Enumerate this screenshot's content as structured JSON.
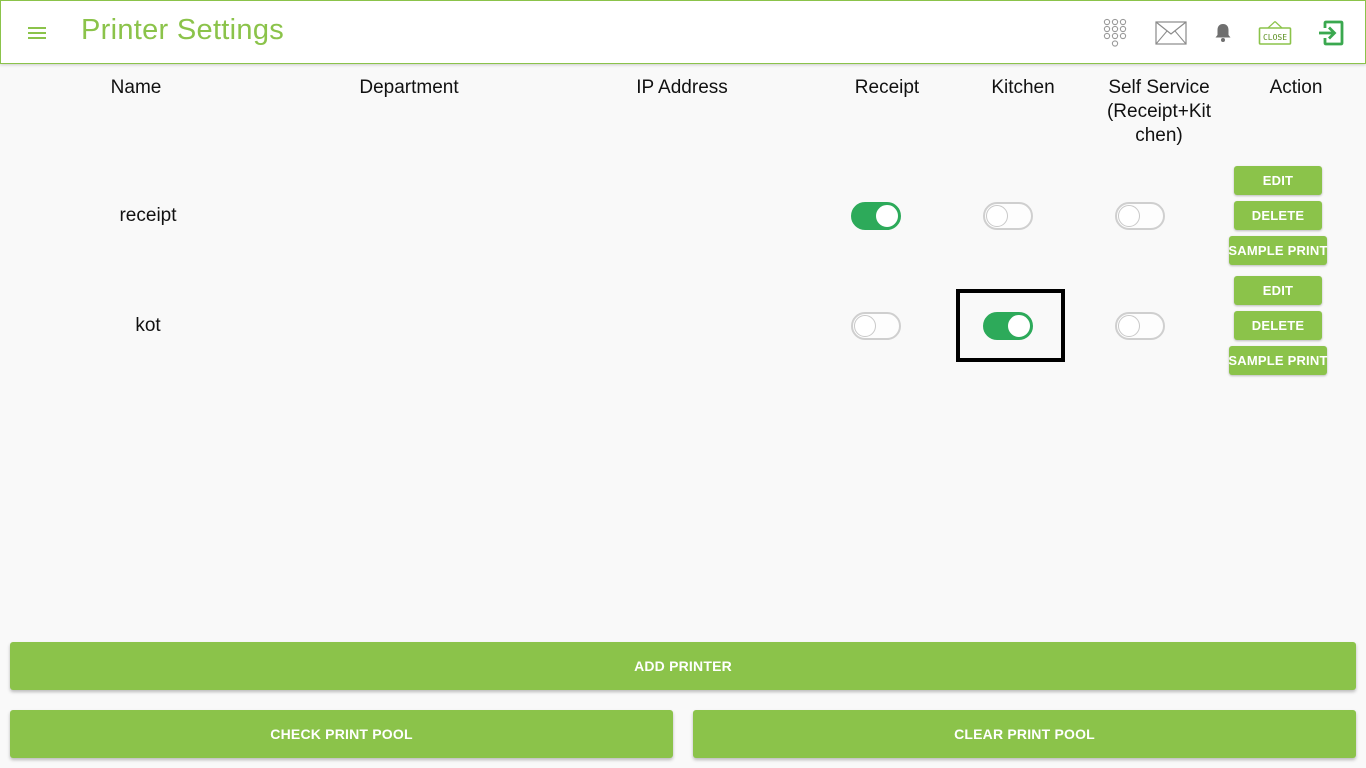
{
  "header": {
    "title": "Printer Settings",
    "close_sign_text": "CLOSE"
  },
  "colors": {
    "accent": "#8bc34a",
    "toggle_on": "#2daa5a",
    "background": "#f9f9f9"
  },
  "table": {
    "columns": [
      "Name",
      "Department",
      "IP Address",
      "Receipt",
      "Kitchen",
      "Self Service(Receipt+Kitchen)",
      "Action"
    ],
    "rows": [
      {
        "name": "receipt",
        "department": "",
        "ip": "",
        "receipt": true,
        "kitchen": false,
        "self_service": false
      },
      {
        "name": "kot",
        "department": "",
        "ip": "",
        "receipt": false,
        "kitchen": true,
        "self_service": false
      }
    ],
    "actions": {
      "edit": "EDIT",
      "delete": "DELETE",
      "sample_print": "SAMPLE PRINT"
    }
  },
  "buttons": {
    "add_printer": "ADD PRINTER",
    "check_print_pool": "CHECK PRINT POOL",
    "clear_print_pool": "CLEAR PRINT POOL"
  },
  "icons": [
    "menu-icon",
    "keypad-icon",
    "mail-icon",
    "bell-icon",
    "close-sign-icon",
    "exit-icon"
  ]
}
